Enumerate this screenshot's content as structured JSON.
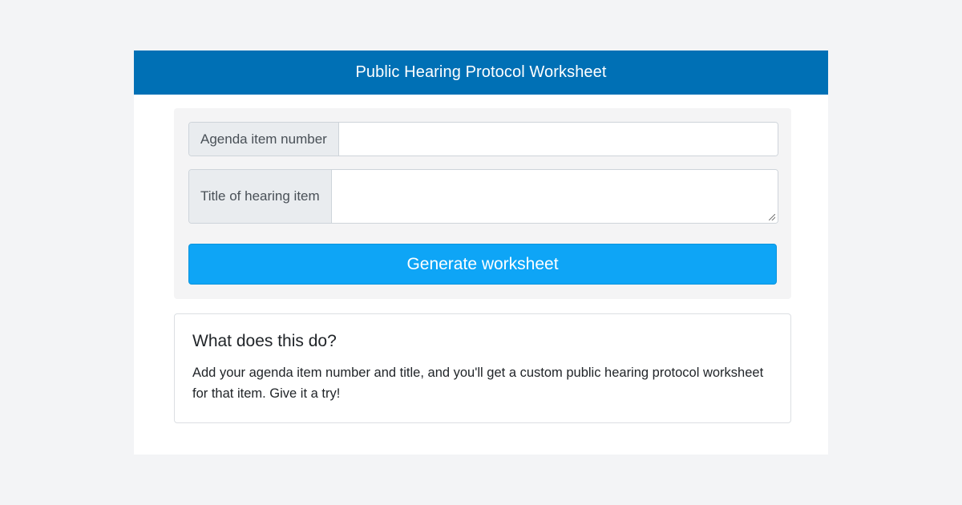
{
  "header": {
    "title": "Public Hearing Protocol Worksheet"
  },
  "form": {
    "agenda_label": "Agenda item number",
    "agenda_value": "",
    "title_label": "Title of hearing item",
    "title_value": "",
    "submit_label": "Generate worksheet"
  },
  "info": {
    "heading": "What does this do?",
    "body": "Add your agenda item number and title, and you'll get a custom public hearing protocol worksheet for that item. Give it a try!"
  },
  "colors": {
    "header_bg": "#0070b5",
    "button_bg": "#0ea5f6",
    "page_bg": "#f3f4f6"
  }
}
